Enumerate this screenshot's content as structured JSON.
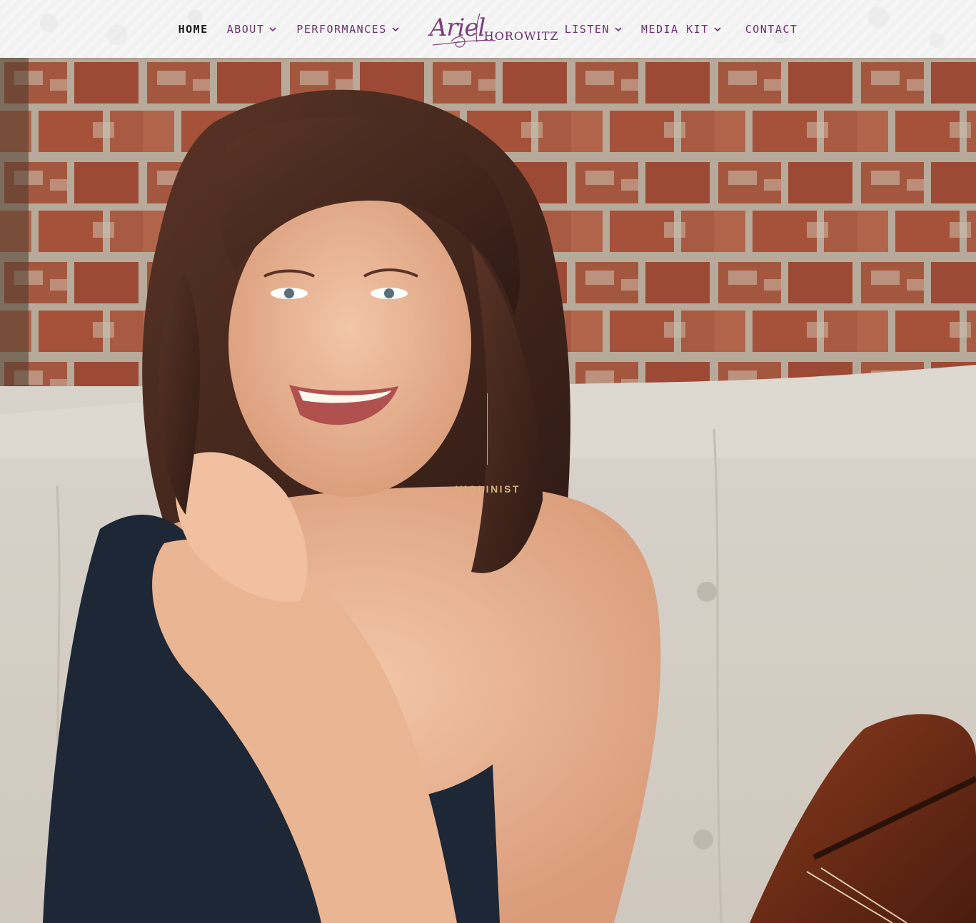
{
  "nav": {
    "items": [
      {
        "label": "HOME",
        "active": true,
        "dropdown": false
      },
      {
        "label": "ABOUT",
        "active": false,
        "dropdown": true
      },
      {
        "label": "PERFORMANCES",
        "active": false,
        "dropdown": true
      },
      {
        "label": "LISTEN",
        "active": false,
        "dropdown": true
      },
      {
        "label": "MEDIA KIT",
        "active": false,
        "dropdown": true
      },
      {
        "label": "CONTACT",
        "active": false,
        "dropdown": false
      }
    ]
  },
  "logo": {
    "script": "Ariel",
    "surname": "HOROWITZ"
  },
  "hero": {
    "tagline": "VIOLINIST"
  },
  "colors": {
    "nav_text": "#6b2e6f",
    "nav_active": "#1a1a1a",
    "tagline": "#d2b27e",
    "accent_line": "#c9a96e"
  },
  "icons": {
    "dropdown": "chevron-down-icon",
    "logo_ornament": "violin-scroll-icon"
  }
}
